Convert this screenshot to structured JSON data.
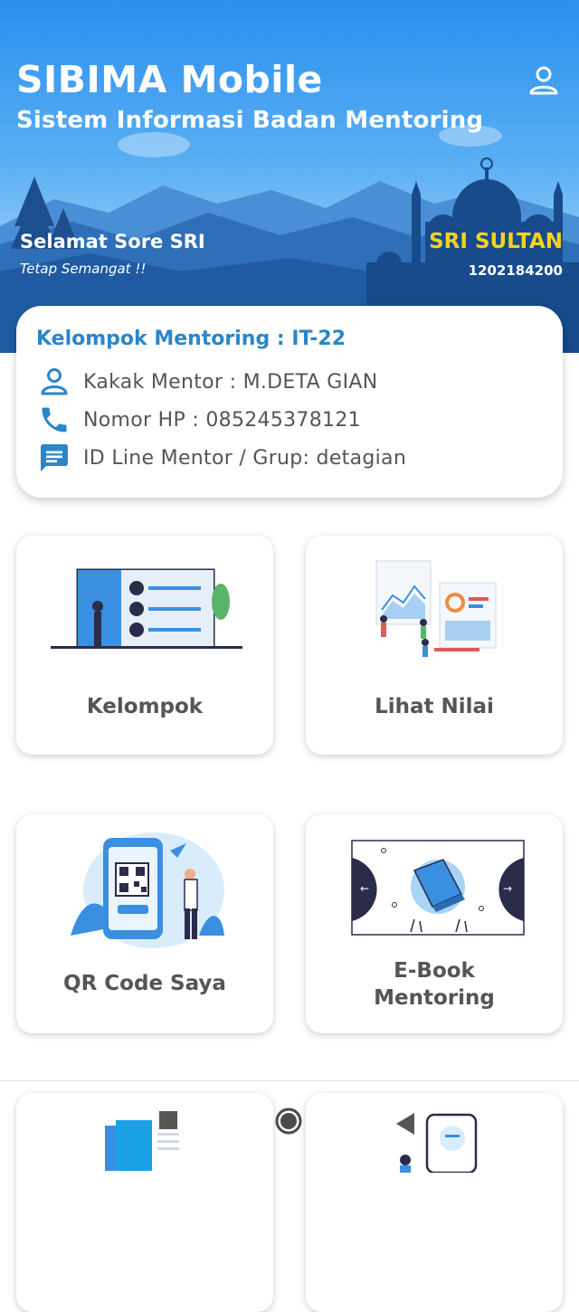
{
  "header": {
    "title": "SIBIMA Mobile",
    "subtitle": "Sistem Informasi Badan Mentoring",
    "greeting": "Selamat Sore SRI",
    "motivation": "Tetap Semangat !!",
    "user_name": "SRI SULTAN",
    "user_id": "1202184200"
  },
  "group_card": {
    "title": "Kelompok Mentoring : IT-22",
    "mentor": "Kakak Mentor : M.DETA GIAN",
    "phone": "Nomor HP : 085245378121",
    "line": "ID Line Mentor / Grup: detagian"
  },
  "menu": {
    "kelompok": "Kelompok",
    "lihat_nilai": "Lihat Nilai",
    "qr_code": "QR Code Saya",
    "ebook_line1": "E-Book",
    "ebook_line2": "Mentoring"
  },
  "colors": {
    "primary_blue": "#2a86c9",
    "name_yellow": "#f6d21f",
    "header_sky": "#2a8ff0"
  }
}
